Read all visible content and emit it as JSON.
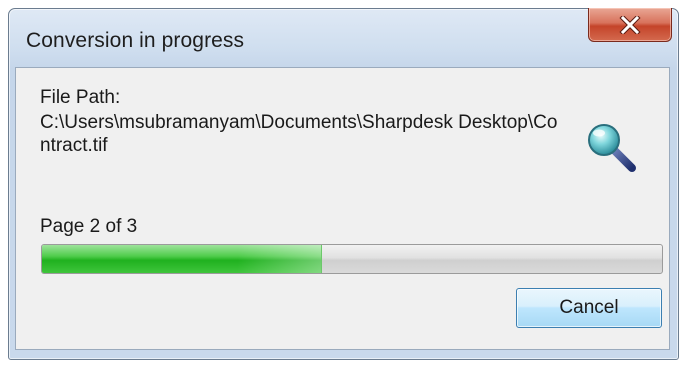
{
  "window": {
    "title": "Conversion in progress",
    "close_icon": "close-icon"
  },
  "file": {
    "label": "File Path:",
    "path": "C:\\Users\\msubramanyam\\Documents\\Sharpdesk Desktop\\Contract.tif",
    "action_icon": "magnifier-icon"
  },
  "progress": {
    "label": "Page 2 of 3",
    "fraction": 0.45,
    "fill_color": "#2fb82d"
  },
  "buttons": {
    "cancel_label": "Cancel"
  },
  "colors": {
    "close_button": "#c94a31",
    "cancel_border": "#3c7fb1",
    "client_background": "#f0f0f0"
  }
}
